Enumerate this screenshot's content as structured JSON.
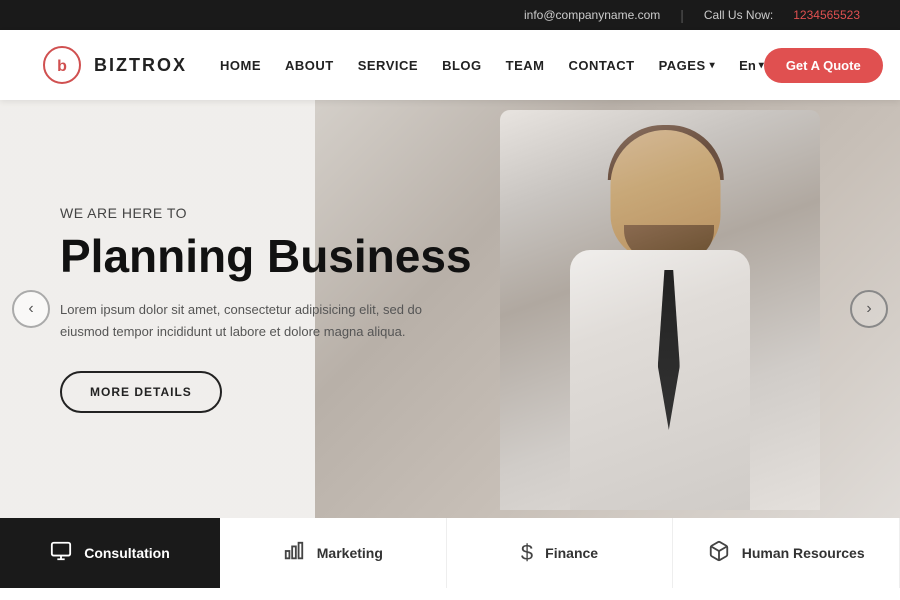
{
  "topbar": {
    "email": "info@companyname.com",
    "divider": "|",
    "call_label": "Call Us Now:",
    "phone": "1234565523"
  },
  "header": {
    "logo_text": "BIZTROX",
    "nav_items": [
      {
        "label": "HOME",
        "id": "home"
      },
      {
        "label": "ABOUT",
        "id": "about"
      },
      {
        "label": "SERVICE",
        "id": "service"
      },
      {
        "label": "BLOG",
        "id": "blog"
      },
      {
        "label": "TEAM",
        "id": "team"
      },
      {
        "label": "CONTACT",
        "id": "contact"
      },
      {
        "label": "PAGES",
        "id": "pages",
        "has_dropdown": true
      },
      {
        "label": "En",
        "id": "lang",
        "has_dropdown": true
      }
    ],
    "quote_btn": "Get A Quote"
  },
  "hero": {
    "subtitle": "WE ARE HERE TO",
    "title": "Planning Business",
    "description": "Lorem ipsum dolor sit amet, consectetur adipisicing elit, sed do eiusmod tempor incididunt ut labore et dolore magna aliqua.",
    "btn_label": "MORE DETAILS",
    "arrow_left": "‹",
    "arrow_right": "›"
  },
  "bottom_bar": {
    "items": [
      {
        "label": "Consultation",
        "icon": "💬",
        "id": "consultation",
        "dark": true
      },
      {
        "label": "Marketing",
        "icon": "📊",
        "id": "marketing"
      },
      {
        "label": "Finance",
        "icon": "$",
        "id": "finance"
      },
      {
        "label": "Human Resources",
        "icon": "📦",
        "id": "hr"
      }
    ]
  }
}
